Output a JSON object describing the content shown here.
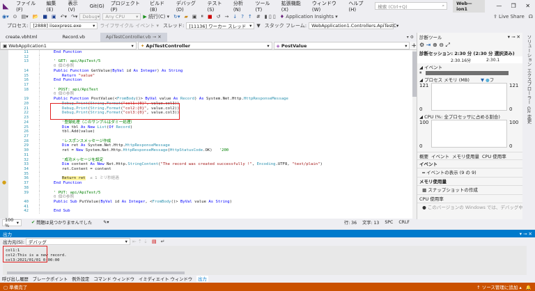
{
  "menu": {
    "items": [
      "ファイル(F)",
      "編集(E)",
      "表示(V)",
      "Git(G)",
      "プロジェクト(P)",
      "ビルド(B)",
      "デバッグ(D)",
      "テスト(S)",
      "分析(N)",
      "ツール(T)",
      "拡張機能(X)",
      "ウィンドウ(W)",
      "ヘルプ(H)"
    ],
    "search_placeholder": "検索 (Ctrl+Q)",
    "window_title": "Web—ion1"
  },
  "toolbar": {
    "config": "Debug",
    "platform": "Any CPU",
    "continue": "続行(C)",
    "app_insights": "Application Insights",
    "live_share": "Live Share"
  },
  "process_bar": {
    "process_label": "プロセス:",
    "process": "[2888] iisexpress.exe",
    "lifecycle": "ライフサイクル イベント",
    "thread_label": "スレッド:",
    "thread": "[11136] ワーカー スレッド",
    "stack_label": "スタック フレーム:",
    "stack": "WebApplication1.Controllers.ApiTestC"
  },
  "tabs": [
    {
      "label": "create.vbhtml"
    },
    {
      "label": "Record.vb"
    },
    {
      "label": "ApiTestController.vb",
      "active": true
    }
  ],
  "nav": {
    "project": "WebApplication1",
    "class": "ApiTestController",
    "member": "PostValue"
  },
  "code": [
    {
      "n": "11",
      "i": 1,
      "tk": [
        [
          "k",
          "End Function"
        ]
      ]
    },
    {
      "n": "12",
      "i": 0,
      "tk": []
    },
    {
      "n": "13",
      "i": 1,
      "tk": [
        [
          "c",
          "' GET: api/ApiTest/5"
        ]
      ]
    },
    {
      "n": "",
      "i": 1,
      "tk": [
        [
          "r",
          "0 個の参照"
        ]
      ]
    },
    {
      "n": "14",
      "i": 1,
      "tk": [
        [
          "k",
          "Public Function "
        ],
        [
          "p",
          "GetValue("
        ],
        [
          "k",
          "ByVal "
        ],
        [
          "p",
          "id "
        ],
        [
          "k",
          "As Integer"
        ],
        [
          "p",
          ") "
        ],
        [
          "k",
          "As String"
        ]
      ]
    },
    {
      "n": "15",
      "i": 2,
      "tk": [
        [
          "k",
          "Return "
        ],
        [
          "s",
          "\"value\""
        ]
      ]
    },
    {
      "n": "16",
      "i": 1,
      "tk": [
        [
          "k",
          "End Function"
        ]
      ]
    },
    {
      "n": "17",
      "i": 0,
      "tk": []
    },
    {
      "n": "18",
      "i": 1,
      "tk": [
        [
          "c",
          "' POST: api/ApiTest"
        ]
      ]
    },
    {
      "n": "",
      "i": 1,
      "tk": [
        [
          "r",
          "0 個の参照"
        ]
      ]
    },
    {
      "n": "19",
      "i": 1,
      "tk": [
        [
          "k",
          "Public Function "
        ],
        [
          "p",
          "PostValue(<"
        ],
        [
          "t",
          "FromBody"
        ],
        [
          "p",
          "()> "
        ],
        [
          "k",
          "ByVal "
        ],
        [
          "p",
          "value "
        ],
        [
          "k",
          "As "
        ],
        [
          "t",
          "Record"
        ],
        [
          "p",
          ") "
        ],
        [
          "k",
          "As "
        ],
        [
          "p",
          "System.Net.Http."
        ],
        [
          "t",
          "HttpResponseMessage"
        ]
      ]
    },
    {
      "n": "20",
      "i": 2,
      "tk": [
        [
          "t",
          "Debug"
        ],
        [
          "p",
          "."
        ],
        [
          "t",
          "Print"
        ],
        [
          "p",
          "("
        ],
        [
          "t",
          "String"
        ],
        [
          "p",
          "."
        ],
        [
          "t",
          "Format"
        ],
        [
          "p",
          "("
        ],
        [
          "s",
          "\"col1:{0}\""
        ],
        [
          "p",
          ", value.col1))"
        ]
      ]
    },
    {
      "n": "21",
      "i": 2,
      "tk": [
        [
          "t",
          "Debug"
        ],
        [
          "p",
          "."
        ],
        [
          "t",
          "Print"
        ],
        [
          "p",
          "("
        ],
        [
          "t",
          "String"
        ],
        [
          "p",
          "."
        ],
        [
          "t",
          "Format"
        ],
        [
          "p",
          "("
        ],
        [
          "s",
          "\"col2:{0}\""
        ],
        [
          "p",
          ", value.col2))"
        ]
      ]
    },
    {
      "n": "22",
      "i": 2,
      "tk": [
        [
          "t",
          "Debug"
        ],
        [
          "p",
          "."
        ],
        [
          "t",
          "Print"
        ],
        [
          "p",
          "("
        ],
        [
          "t",
          "String"
        ],
        [
          "p",
          "."
        ],
        [
          "t",
          "Format"
        ],
        [
          "p",
          "("
        ],
        [
          "s",
          "\"col3:{0}\""
        ],
        [
          "p",
          ", value.col3))"
        ]
      ]
    },
    {
      "n": "23",
      "i": 0,
      "tk": []
    },
    {
      "n": "24",
      "i": 2,
      "tk": [
        [
          "c",
          "'登録処理（このサンプルはダミー処理）"
        ]
      ]
    },
    {
      "n": "25",
      "i": 2,
      "tk": [
        [
          "k",
          "Dim "
        ],
        [
          "p",
          "tbl "
        ],
        [
          "k",
          "As New "
        ],
        [
          "t",
          "List"
        ],
        [
          "p",
          "("
        ],
        [
          "k",
          "Of "
        ],
        [
          "t",
          "Record"
        ],
        [
          "p",
          ")"
        ]
      ]
    },
    {
      "n": "26",
      "i": 2,
      "tk": [
        [
          "p",
          "tbl.Add(value)"
        ]
      ]
    },
    {
      "n": "27",
      "i": 0,
      "tk": []
    },
    {
      "n": "28",
      "i": 2,
      "tk": [
        [
          "c",
          "'レスポンスメッセージ作成"
        ]
      ]
    },
    {
      "n": "29",
      "i": 2,
      "tk": [
        [
          "k",
          "Dim "
        ],
        [
          "p",
          "ret "
        ],
        [
          "k",
          "As "
        ],
        [
          "p",
          "System.Net.Http."
        ],
        [
          "t",
          "HttpResponseMessage"
        ]
      ]
    },
    {
      "n": "30",
      "i": 2,
      "tk": [
        [
          "p",
          "ret = "
        ],
        [
          "k",
          "New "
        ],
        [
          "p",
          "System.Net.Http."
        ],
        [
          "t",
          "HttpResponseMessage"
        ],
        [
          "p",
          "("
        ],
        [
          "t",
          "HttpStatusCode"
        ],
        [
          "p",
          ".OK)   "
        ],
        [
          "c",
          "'200"
        ]
      ]
    },
    {
      "n": "31",
      "i": 0,
      "tk": []
    },
    {
      "n": "32",
      "i": 2,
      "tk": [
        [
          "c",
          "'成功メッセージを設定"
        ]
      ]
    },
    {
      "n": "33",
      "i": 2,
      "tk": [
        [
          "k",
          "Dim "
        ],
        [
          "p",
          "content "
        ],
        [
          "k",
          "As New "
        ],
        [
          "p",
          "Net.Http."
        ],
        [
          "t",
          "StringContent"
        ],
        [
          "p",
          "("
        ],
        [
          "s",
          "\"The record was created successfully !\""
        ],
        [
          "p",
          ", "
        ],
        [
          "t",
          "Encoding"
        ],
        [
          "p",
          ".UTF8, "
        ],
        [
          "s",
          "\"text/plain\""
        ],
        [
          "p",
          ")"
        ]
      ]
    },
    {
      "n": "34",
      "i": 2,
      "tk": [
        [
          "p",
          "ret.Content = content"
        ]
      ]
    },
    {
      "n": "35",
      "i": 0,
      "tk": []
    },
    {
      "n": "36",
      "i": 2,
      "tk": [
        [
          "h",
          "Return ret"
        ],
        [
          "r",
          "  ≤ 1 ミリ秒経過"
        ]
      ]
    },
    {
      "n": "37",
      "i": 1,
      "tk": [
        [
          "k",
          "End Function"
        ]
      ]
    },
    {
      "n": "38",
      "i": 0,
      "tk": []
    },
    {
      "n": "39",
      "i": 1,
      "tk": [
        [
          "c",
          "' PUT: api/ApiTest/5"
        ]
      ]
    },
    {
      "n": "",
      "i": 1,
      "tk": [
        [
          "r",
          "0 個の参照"
        ]
      ]
    },
    {
      "n": "40",
      "i": 1,
      "tk": [
        [
          "k",
          "Public Sub "
        ],
        [
          "p",
          "PutValue("
        ],
        [
          "k",
          "ByVal "
        ],
        [
          "p",
          "id "
        ],
        [
          "k",
          "As Integer"
        ],
        [
          "p",
          ", <"
        ],
        [
          "t",
          "FromBody"
        ],
        [
          "p",
          "()> "
        ],
        [
          "k",
          "ByVal "
        ],
        [
          "p",
          "value "
        ],
        [
          "k",
          "As String"
        ],
        [
          "p",
          ")"
        ]
      ]
    },
    {
      "n": "41",
      "i": 0,
      "tk": []
    },
    {
      "n": "42",
      "i": 1,
      "tk": [
        [
          "k",
          "End Sub"
        ]
      ]
    }
  ],
  "editor_status": {
    "zoom": "100 %",
    "issues": "問題は見つかりませんでした",
    "line": "行: 36",
    "col": "文字: 13",
    "spc": "SPC",
    "eol": "CRLF"
  },
  "diag": {
    "title": "診断ツール",
    "session": "診断セッション: 2:30 分 (2:30 分 選択済み)",
    "tick1": "2:30.16分",
    "tick2": "2:30.1",
    "events": "イベント",
    "memory": "プロセス メモリ (MB)",
    "mem_legend": "フ",
    "mem_max": "121",
    "mem_min": "0",
    "cpu": "CPU (%: 全プロセッサに占める割合)",
    "cpu_max": "100",
    "cpu_min": "0",
    "tabs": [
      "概要",
      "イベント",
      "メモリ使用量",
      "CPU 使用率"
    ],
    "sections": [
      {
        "h": "イベント",
        "item": "イベントの表示 (9 の 9)"
      },
      {
        "h": "メモリ使用量",
        "item": "スナップショットの作成"
      },
      {
        "h": "CPU 使用率",
        "item": "このバージョンの Windows では、デバッグ中"
      }
    ]
  },
  "right_strip": [
    "ソリューション エクスプローラー",
    "Git 変更"
  ],
  "output": {
    "title": "出力",
    "source_label": "出力元(S):",
    "source": "デバッグ",
    "lines": [
      "col1:1",
      "col2:This is a new record.",
      "col3:2021/01/01 0:00:00"
    ]
  },
  "bottom_tabs": [
    "呼び出し履歴",
    "ブレークポイント",
    "例外設定",
    "コマンド ウィンドウ",
    "イミディエイト ウィンドウ",
    "出力"
  ],
  "status": {
    "ready": "準備完了",
    "source_control": "ソース管理に追加"
  },
  "colors": {
    "accent": "#007acc",
    "status_bar": "#ca5100",
    "highlight_box": "#e02020"
  }
}
